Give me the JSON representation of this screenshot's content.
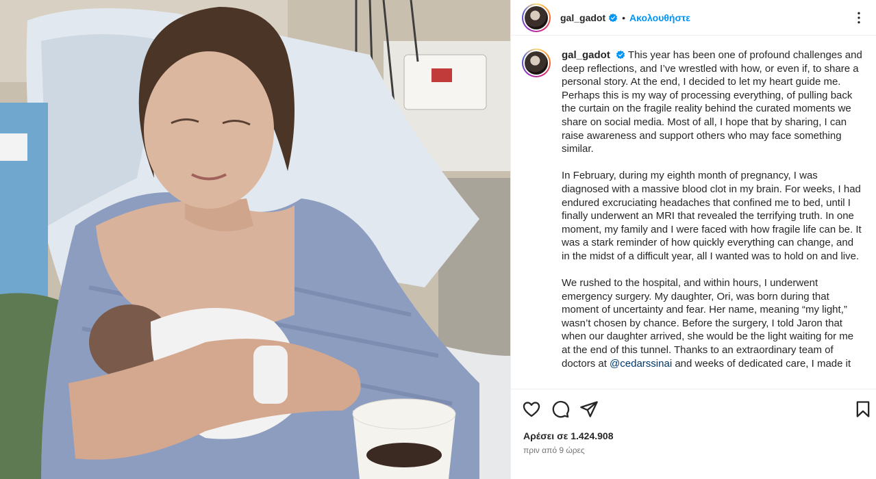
{
  "post": {
    "username": "gal_gadot",
    "follow_label": "Ακολουθήστε",
    "separator": "•",
    "caption_paragraphs": [
      "This year has been one of profound challenges and deep reflections, and I’ve wrestled with how, or even if, to share a personal story. At the end, I decided to let my heart guide me. Perhaps this is my way of processing everything, of pulling back the curtain on the fragile reality behind the curated moments we share on social media. Most of all, I hope that by sharing, I can raise awareness and support others who may face something similar.",
      "In February, during my eighth month of pregnancy, I was diagnosed with a massive blood clot in my brain. For weeks, I had endured excruciating headaches that confined me to bed, until I finally underwent an MRI that revealed the terrifying truth. In one moment, my family and I were faced with how fragile life can be. It was a stark reminder of how quickly everything can change, and in the midst of a difficult year, all I wanted was to hold on and live."
    ],
    "caption_p3_before": "We rushed to the hospital, and within hours, I underwent emergency surgery. My daughter, Ori, was born during that moment of uncertainty and fear. Her name, meaning “my light,” wasn’t chosen by chance. Before the surgery, I told Jaron that when our daughter arrived, she would be the light waiting for me at the end of this tunnel. Thanks to an extraordinary team of doctors at ",
    "caption_p3_mention": "@cedarssinai",
    "caption_p3_after": " and weeks of dedicated care, I made it",
    "likes_text": "Αρέσει σε 1.424.908",
    "time_text": "πριν από 9 ώρες"
  },
  "icons": {
    "verified": "verified-badge-icon",
    "more": "more-options-icon",
    "like": "heart-icon",
    "comment": "comment-icon",
    "share": "send-icon",
    "save": "bookmark-icon"
  },
  "colors": {
    "accent": "#0095f6",
    "mention": "#00376b",
    "text": "#262626",
    "secondary": "#737373"
  }
}
